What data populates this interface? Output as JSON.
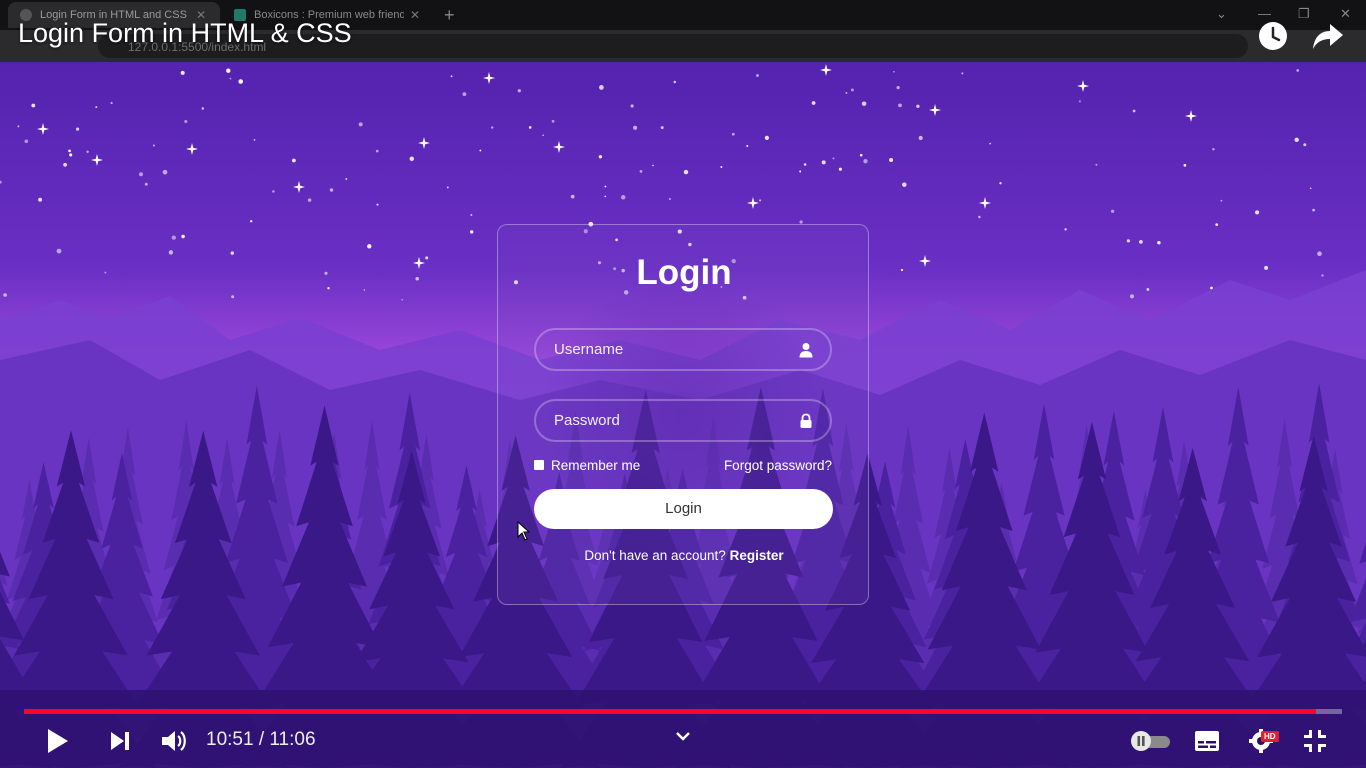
{
  "browser": {
    "tabs": [
      {
        "label": "Login Form in HTML and CSS | Co",
        "active": true
      },
      {
        "label": "Boxicons : Premium web friendly",
        "active": false
      }
    ],
    "url": "127.0.0.1:5500/index.html"
  },
  "video": {
    "title": "Login Form in HTML & CSS",
    "time_display": "10:51 / 11:06",
    "progress": 0.98,
    "quality_badge": "HD",
    "accent": "#ff0033"
  },
  "login_form": {
    "title": "Login",
    "username_placeholder": "Username",
    "password_placeholder": "Password",
    "remember_label": "Remember me",
    "forgot_label": "Forgot password?",
    "button_label": "Login",
    "register_prompt": "Don't have an account?",
    "register_link": "Register"
  },
  "icons": {
    "username": "user-icon",
    "password": "lock-icon"
  }
}
